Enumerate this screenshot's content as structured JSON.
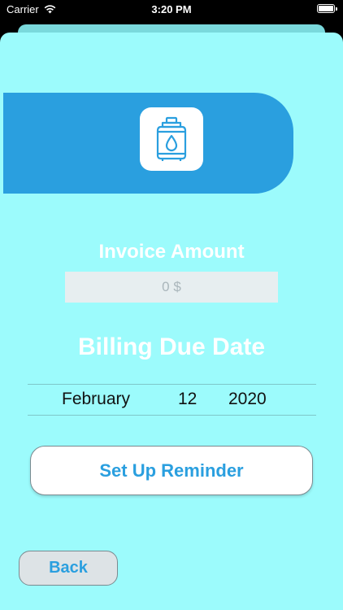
{
  "status_bar": {
    "carrier": "Carrier",
    "time": "3:20 PM"
  },
  "header": {
    "icon": "gas-cylinder-icon"
  },
  "invoice": {
    "label": "Invoice Amount",
    "placeholder": "0 $",
    "value": ""
  },
  "due_date": {
    "label": "Billing Due Date",
    "month": "February",
    "day": "12",
    "year": "2020"
  },
  "actions": {
    "setup_label": "Set Up Reminder",
    "back_label": "Back"
  },
  "colors": {
    "background": "#9cfbfc",
    "accent": "#2a9fdf",
    "field": "#e7eef0"
  }
}
